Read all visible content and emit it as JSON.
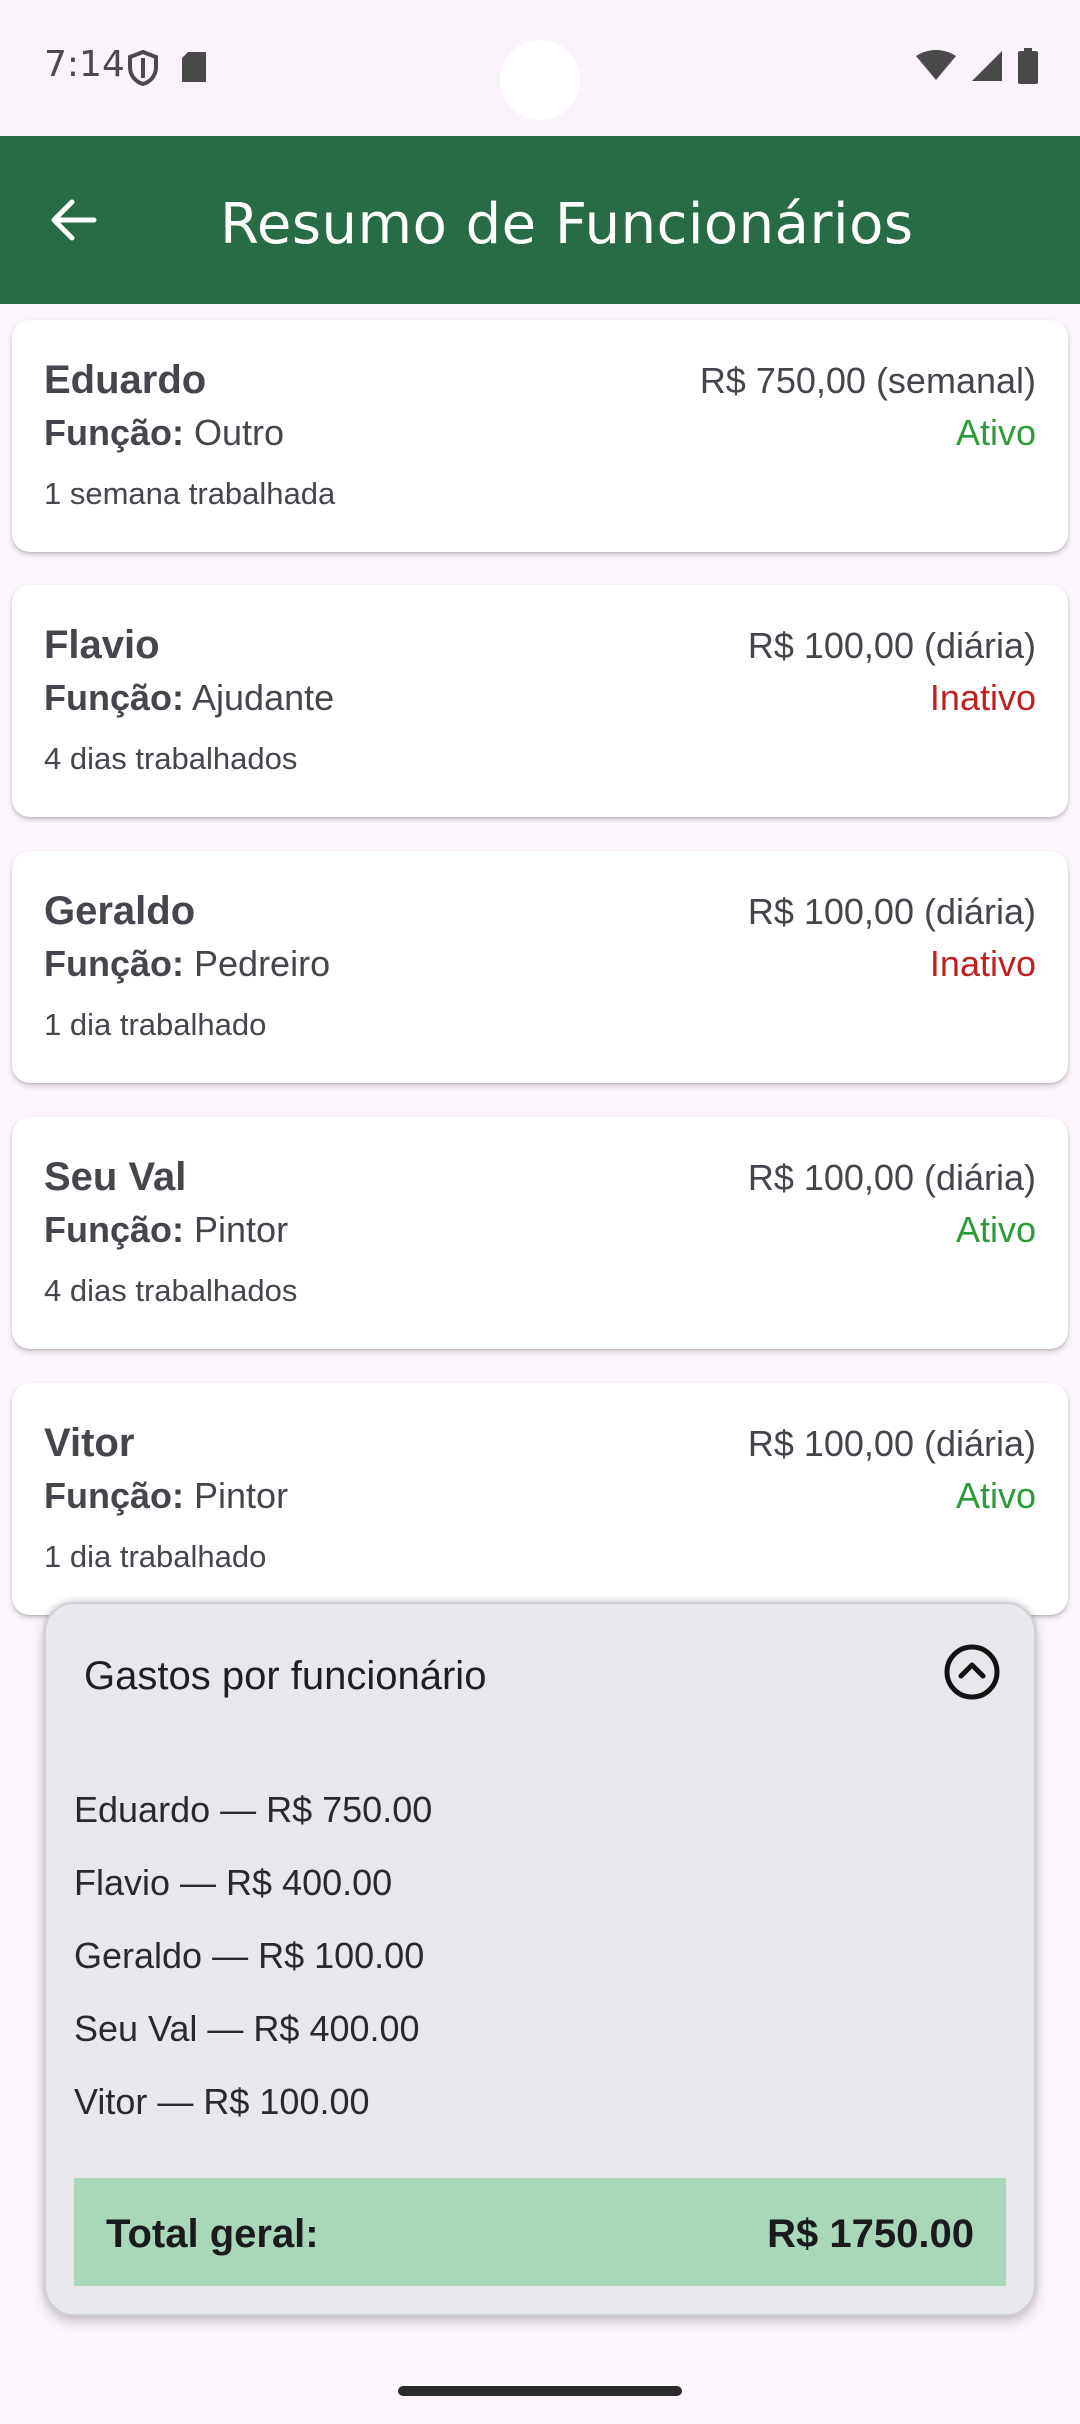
{
  "status_bar": {
    "time": "7:14",
    "left_icons": [
      "shield-icon",
      "sd-card-icon"
    ],
    "right_icons": [
      "wifi-icon",
      "signal-icon",
      "battery-icon"
    ]
  },
  "app_bar": {
    "title": "Resumo de Funcionários",
    "back_icon": "arrow-back-icon",
    "background": "#276b47"
  },
  "colors": {
    "active": "#2e9a3a",
    "inactive": "#c0211f",
    "total_bg": "#a8d8b9"
  },
  "employees": [
    {
      "name": "Eduardo",
      "role_label": "Função:",
      "role": "Outro",
      "days": "1 semana trabalhada",
      "pay": "R$ 750,00 (semanal)",
      "status": "Ativo",
      "active": true
    },
    {
      "name": "Flavio",
      "role_label": "Função:",
      "role": "Ajudante",
      "days": "4 dias trabalhados",
      "pay": "R$ 100,00 (diária)",
      "status": "Inativo",
      "active": false
    },
    {
      "name": "Geraldo",
      "role_label": "Função:",
      "role": "Pedreiro",
      "days": "1 dia trabalhado",
      "pay": "R$ 100,00 (diária)",
      "status": "Inativo",
      "active": false
    },
    {
      "name": "Seu Val",
      "role_label": "Função:",
      "role": "Pintor",
      "days": "4 dias trabalhados",
      "pay": "R$ 100,00 (diária)",
      "status": "Ativo",
      "active": true
    },
    {
      "name": "Vitor",
      "role_label": "Função:",
      "role": "Pintor",
      "days": "1 dia trabalhado",
      "pay": "R$ 100,00 (diária)",
      "status": "Ativo",
      "active": true
    }
  ],
  "summary": {
    "title": "Gastos por funcionário",
    "collapse_icon": "chevron-up-circle-icon",
    "items": [
      "Eduardo — R$ 750.00",
      "Flavio — R$ 400.00",
      "Geraldo — R$ 100.00",
      "Seu Val — R$ 400.00",
      "Vitor — R$ 100.00"
    ],
    "total_label": "Total geral:",
    "total_value": "R$ 1750.00"
  }
}
